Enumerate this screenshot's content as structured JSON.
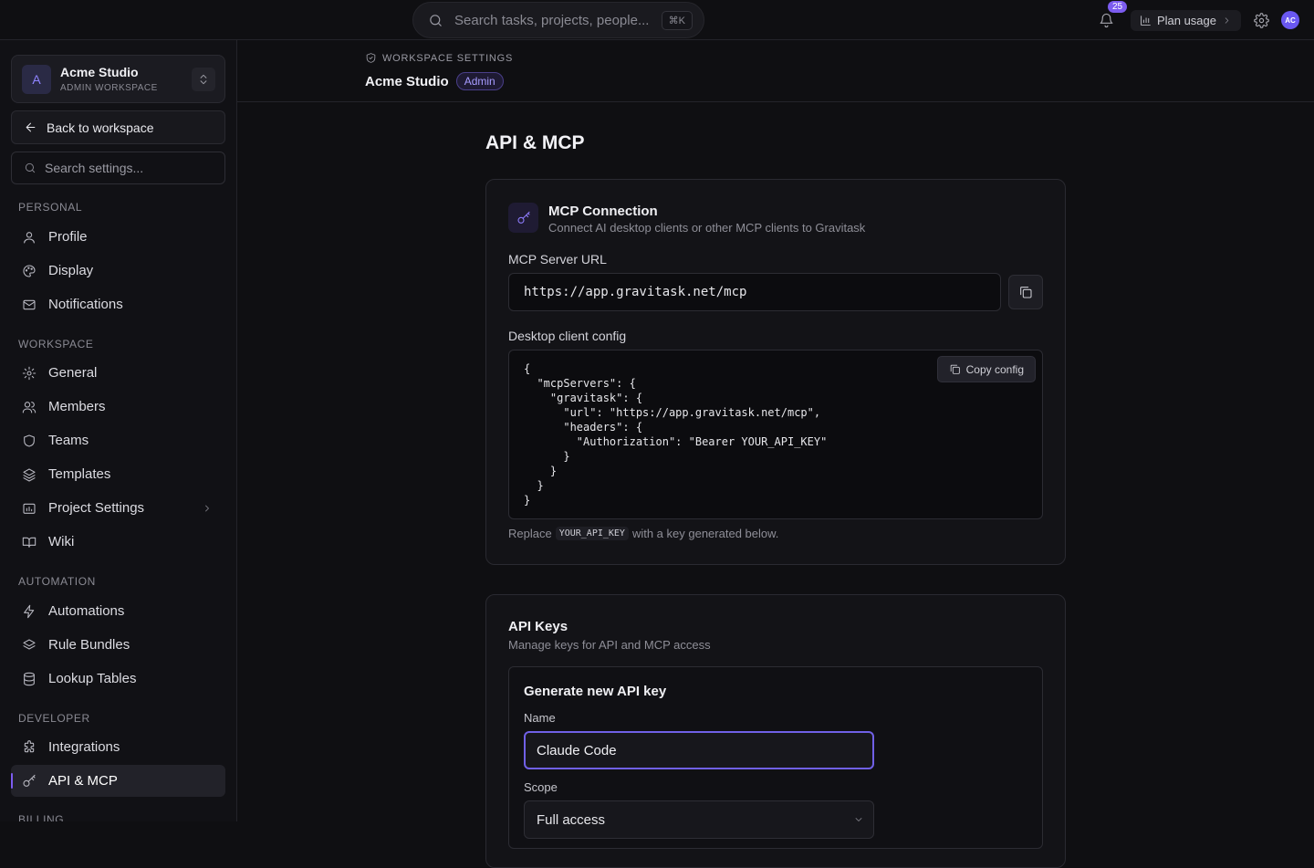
{
  "topbar": {
    "search_placeholder": "Search tasks, projects, people...",
    "search_shortcut": "⌘K",
    "notification_count": "25",
    "plan_usage_label": "Plan usage",
    "avatar_initials": "AC"
  },
  "sidebar": {
    "workspace": {
      "initial": "A",
      "name": "Acme Studio",
      "subtitle": "ADMIN WORKSPACE"
    },
    "back_label": "Back to workspace",
    "search_placeholder": "Search settings...",
    "sections": {
      "personal": "PERSONAL",
      "workspace": "WORKSPACE",
      "automation": "AUTOMATION",
      "developer": "DEVELOPER",
      "billing": "BILLING"
    },
    "items": {
      "profile": "Profile",
      "display": "Display",
      "notifications": "Notifications",
      "general": "General",
      "members": "Members",
      "teams": "Teams",
      "templates": "Templates",
      "project_settings": "Project Settings",
      "wiki": "Wiki",
      "automations": "Automations",
      "rule_bundles": "Rule Bundles",
      "lookup_tables": "Lookup Tables",
      "integrations": "Integrations",
      "api_mcp": "API & MCP"
    }
  },
  "header": {
    "breadcrumb": "WORKSPACE SETTINGS",
    "workspace_name": "Acme Studio",
    "role_badge": "Admin"
  },
  "main": {
    "title": "API & MCP",
    "mcp": {
      "title": "MCP Connection",
      "subtitle": "Connect AI desktop clients or other MCP clients to Gravitask",
      "server_url_label": "MCP Server URL",
      "server_url": "https://app.gravitask.net/mcp",
      "config_label": "Desktop client config",
      "copy_config_label": "Copy config",
      "config_code": "{\n  \"mcpServers\": {\n    \"gravitask\": {\n      \"url\": \"https://app.gravitask.net/mcp\",\n      \"headers\": {\n        \"Authorization\": \"Bearer YOUR_API_KEY\"\n      }\n    }\n  }\n}",
      "hint_prefix": "Replace",
      "hint_code": "YOUR_API_KEY",
      "hint_suffix": "with a key generated below."
    },
    "api_keys": {
      "title": "API Keys",
      "subtitle": "Manage keys for API and MCP access",
      "generate_title": "Generate new API key",
      "name_label": "Name",
      "name_value": "Claude Code",
      "scope_label": "Scope",
      "scope_value": "Full access"
    }
  },
  "colors": {
    "accent": "#7c5cf0",
    "background": "#0f0f12",
    "card": "#131317"
  }
}
